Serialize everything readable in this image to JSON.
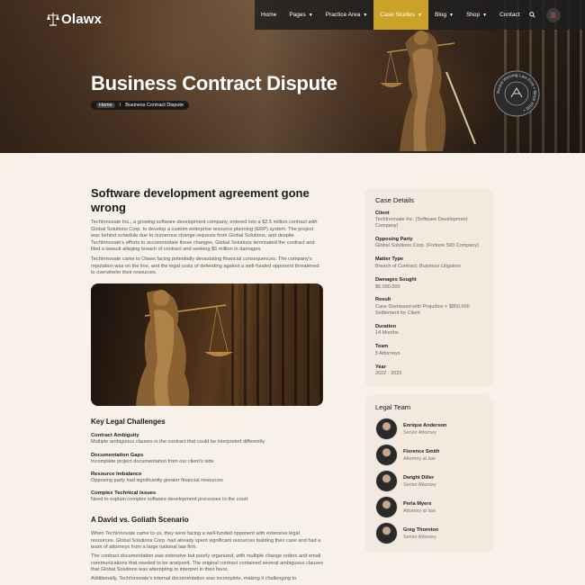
{
  "brand": {
    "logo_text": "Olawx"
  },
  "nav": {
    "items": [
      {
        "label": "Home",
        "caret": false,
        "active": false
      },
      {
        "label": "Pages",
        "caret": true,
        "active": false
      },
      {
        "label": "Practice Area",
        "caret": true,
        "active": false
      },
      {
        "label": "Case Studies",
        "caret": true,
        "active": true
      },
      {
        "label": "Blog",
        "caret": true,
        "active": false
      },
      {
        "label": "Shop",
        "caret": true,
        "active": false
      },
      {
        "label": "Contact",
        "caret": false,
        "active": false
      }
    ],
    "accent_color": "#c9a227"
  },
  "hero": {
    "title": "Business Contract Dispute",
    "breadcrumb": {
      "home": "Home",
      "separator": "/",
      "current": "Business Contract Dispute"
    },
    "badge_text": "Award-Winning Law Firm • Since 2005 •"
  },
  "article": {
    "heading": "Software development agreement gone wrong",
    "paragraph1": "TechInnovate Inc., a growing software development company, entered into a $2.5 million contract with Global Solutions Corp. to develop a custom enterprise resource planning (ERP) system. The project was behind schedule due to numerous change requests from Global Solutions, and despite TechInnovate's efforts to accommodate these changes, Global Solutions terminated the contract and filed a lawsuit alleging breach of contract and seeking $5 million in damages.",
    "paragraph2": "TechInnovate came to Olawx facing potentially devastating financial consequences. The company's reputation was on the line, and the legal costs of defending against a well-funded opponent threatened to overwhelm their resources.",
    "challenges_heading": "Key Legal Challenges",
    "challenges": [
      {
        "title": "Contract Ambiguity",
        "desc": "Multiple ambiguous clauses in the contract that could be interpreted differently"
      },
      {
        "title": "Documentation Gaps",
        "desc": "Incomplete project documentation from our client's side"
      },
      {
        "title": "Resource Imbalance",
        "desc": "Opposing party had significantly greater financial resources"
      },
      {
        "title": "Complex Technical Issues",
        "desc": "Need to explain complex software development processes to the court"
      }
    ],
    "scenario_heading": "A David vs. Goliath Scenario",
    "paragraph3": "When TechInnovate came to us, they were facing a well-funded opponent with extensive legal resources. Global Solutions Corp. had already spent significant resources building their case and had a team of attorneys from a large national law firm.",
    "paragraph4": "The contract documentation was extensive but poorly organized, with multiple change orders and email communications that needed to be analyzed. The original contract contained several ambiguous clauses that Global Solutions was attempting to interpret in their favor.",
    "paragraph5": "Additionally, TechInnovate's internal documentation was incomplete, making it challenging to"
  },
  "case_details": {
    "title": "Case Details",
    "items": [
      {
        "label": "Client",
        "value": "TechInnovate Inc. (Software Development Company)"
      },
      {
        "label": "Opposing Party",
        "value": "Global Solutions Corp. (Fortune 500 Company)"
      },
      {
        "label": "Matter Type",
        "value": "Breach of Contract, Business Litigation"
      },
      {
        "label": "Damages Sought",
        "value": "$5,000,000"
      },
      {
        "label": "Result",
        "value": "Case Dismissed with Prejudice + $850,000 Settlement for Client"
      },
      {
        "label": "Duration",
        "value": "14 Months"
      },
      {
        "label": "Team",
        "value": "5 Attorneys"
      },
      {
        "label": "Year",
        "value": "2022 - 2023"
      }
    ]
  },
  "legal_team": {
    "title": "Legal Team",
    "members": [
      {
        "name": "Enrique Anderson",
        "role": "Senior Attorney"
      },
      {
        "name": "Florence Smith",
        "role": "Attorney at law"
      },
      {
        "name": "Dwight Diller",
        "role": "Senior Attorney"
      },
      {
        "name": "Perla Myers",
        "role": "Attorney at law"
      },
      {
        "name": "Greg Thornton",
        "role": "Senior Attorney"
      }
    ]
  }
}
